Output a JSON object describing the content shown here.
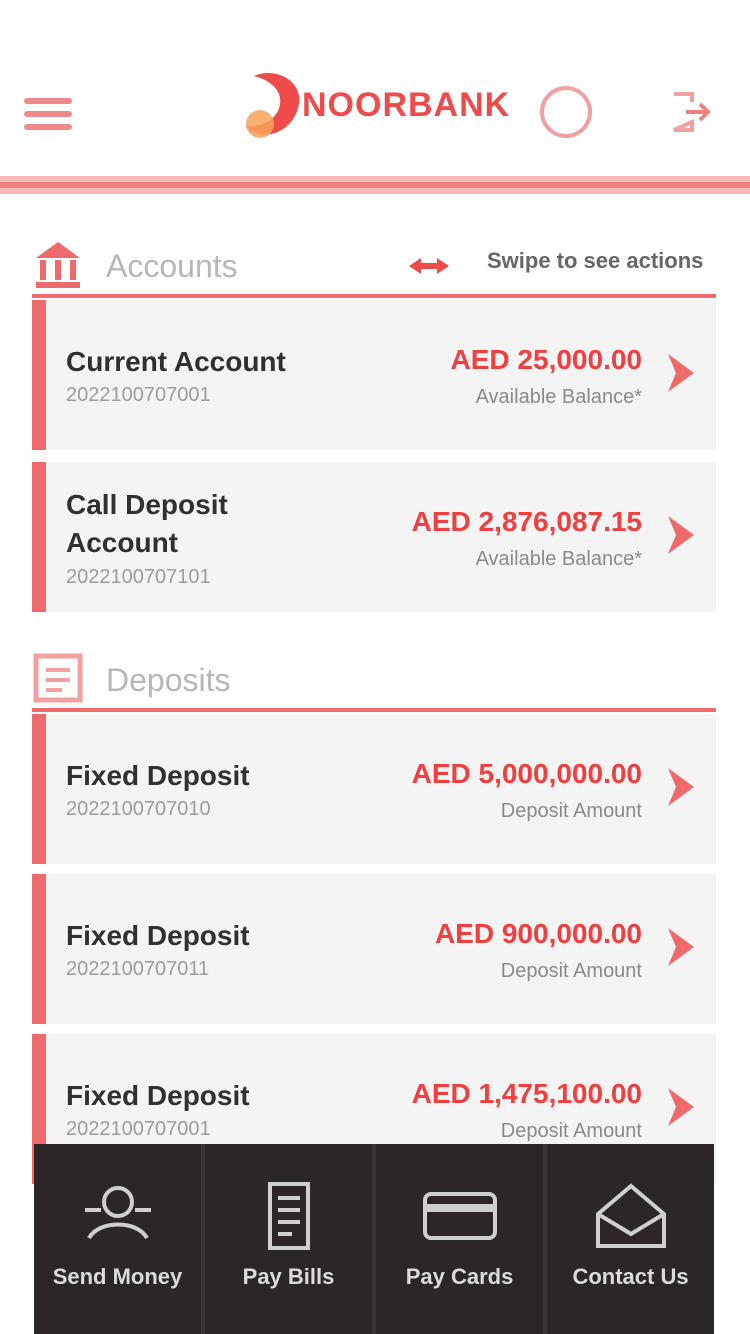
{
  "header": {
    "brand_name": "NOORBANK",
    "colors": {
      "accent": "#ef4b4b",
      "accent_light": "#f6b7b7",
      "dark_bar": "#2c2628"
    }
  },
  "accounts_section": {
    "title": "Accounts",
    "hint_text": "Swipe to see actions",
    "items": [
      {
        "title": "Current Account",
        "number": "2022100707001",
        "amount": "AED 25,000.00",
        "sub": "Available Balance*"
      },
      {
        "title": "Call Deposit Account",
        "number": "2022100707101",
        "amount": "AED 2,876,087.15",
        "sub": "Available Balance*"
      }
    ]
  },
  "deposits_section": {
    "title": "Deposits",
    "items": [
      {
        "title": "Fixed Deposit",
        "number": "2022100707010",
        "amount": "AED 5,000,000.00",
        "sub": "Deposit Amount"
      },
      {
        "title": "Fixed Deposit",
        "number": "2022100707011",
        "amount": "AED 900,000.00",
        "sub": "Deposit Amount"
      },
      {
        "title": "Fixed Deposit",
        "number": "2022100707001",
        "amount": "AED 1,475,100.00",
        "sub": "Deposit Amount"
      }
    ]
  },
  "bottom_nav": [
    {
      "label": "Send Money",
      "icon": "send-money-icon"
    },
    {
      "label": "Pay Bills",
      "icon": "pay-bills-icon"
    },
    {
      "label": "Pay Cards",
      "icon": "pay-cards-icon"
    },
    {
      "label": "Contact Us",
      "icon": "contact-us-icon"
    }
  ]
}
